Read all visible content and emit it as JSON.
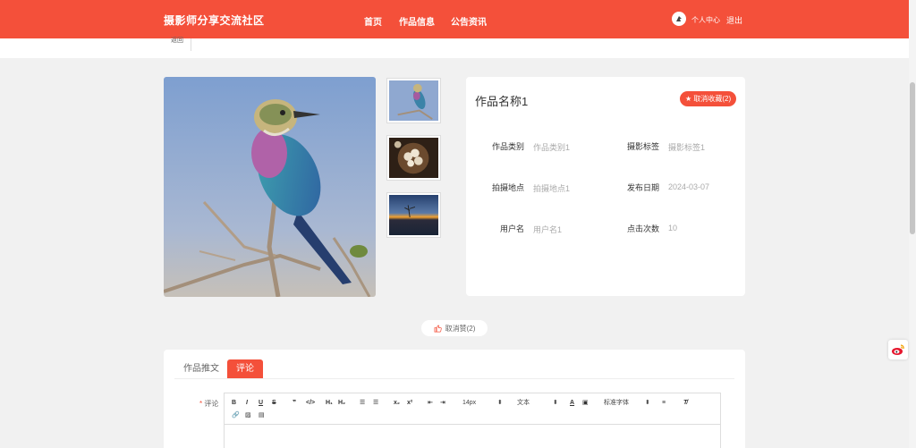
{
  "header": {
    "brand": "摄影师分享交流社区",
    "nav": [
      "首页",
      "作品信息",
      "公告资讯"
    ],
    "user_center": "个人中心",
    "logout": "退出"
  },
  "breadcrumb": {
    "back": "返回"
  },
  "work": {
    "title": "作品名称1",
    "fav_button": "★ 取消收藏(2)",
    "fields": [
      {
        "label": "作品类别",
        "value": "作品类别1"
      },
      {
        "label": "摄影标签",
        "value": "摄影标签1"
      },
      {
        "label": "拍摄地点",
        "value": "拍摄地点1"
      },
      {
        "label": "发布日期",
        "value": "2024-03-07"
      },
      {
        "label": "用户名",
        "value": "用户名1"
      },
      {
        "label": "点击次数",
        "value": "10"
      }
    ]
  },
  "like_button": "取消赞(2)",
  "tabs": [
    "作品推文",
    "评论"
  ],
  "comment": {
    "label": "评论",
    "required_mark": "*",
    "toolbar": {
      "font_size": "14px",
      "block_type": "文本",
      "font_family": "标准字体"
    }
  },
  "colors": {
    "accent": "#f4503a"
  }
}
